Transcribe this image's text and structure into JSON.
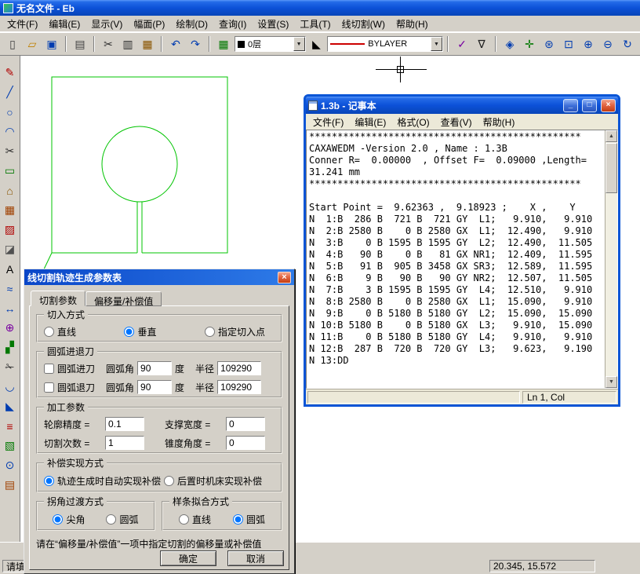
{
  "colors": {
    "titlebar_blue": "#0C51D8",
    "drawing_green": "#00C400",
    "bylayer_red": "#CC0000",
    "layer_chip": "#000000"
  },
  "app": {
    "title": "无名文件 - Eb",
    "menu": [
      "文件(F)",
      "编辑(E)",
      "显示(V)",
      "幅面(P)",
      "绘制(D)",
      "查询(I)",
      "设置(S)",
      "工具(T)",
      "线切割(W)",
      "帮助(H)"
    ],
    "toolbar": {
      "dropdown_glyph": "▼",
      "color_glyph": "◣",
      "layer_value": "0层",
      "line_value": "BYLAYER",
      "file_icons": [
        {
          "name": "new-file-icon",
          "glyph": "▯",
          "color": "#404040"
        },
        {
          "name": "open-file-icon",
          "glyph": "▱",
          "color": "#c08000"
        },
        {
          "name": "save-file-icon",
          "glyph": "▣",
          "color": "#003cb0"
        }
      ],
      "print_icons": [
        {
          "name": "print-icon",
          "glyph": "▤",
          "color": "#404040"
        }
      ],
      "edit_icons": [
        {
          "name": "cut-icon",
          "glyph": "✂",
          "color": "#303030"
        },
        {
          "name": "copy-icon",
          "glyph": "▥",
          "color": "#303030"
        },
        {
          "name": "paste-icon",
          "glyph": "▦",
          "color": "#8a5500"
        }
      ],
      "undo_icons": [
        {
          "name": "undo-icon",
          "glyph": "↶",
          "color": "#003cb0"
        },
        {
          "name": "redo-icon",
          "glyph": "↷",
          "color": "#003cb0"
        }
      ],
      "layer_icons": [
        {
          "name": "layers-icon",
          "glyph": "▦",
          "color": "#007800"
        }
      ],
      "pen_icons": [
        {
          "name": "style-check-icon",
          "glyph": "✓",
          "color": "#7800a0"
        },
        {
          "name": "nabla-tool-icon",
          "glyph": "∇",
          "color": "#202020"
        }
      ],
      "view_icons": [
        {
          "name": "show-all-icon",
          "glyph": "◈",
          "color": "#003cb0"
        },
        {
          "name": "pan-view-icon",
          "glyph": "✛",
          "color": "#007800"
        },
        {
          "name": "zoom-dynamic-icon",
          "glyph": "⊛",
          "color": "#003cb0"
        },
        {
          "name": "zoom-window-icon",
          "glyph": "⊡",
          "color": "#003cb0"
        },
        {
          "name": "zoom-in-icon",
          "glyph": "⊕",
          "color": "#003cb0"
        },
        {
          "name": "zoom-out-icon",
          "glyph": "⊖",
          "color": "#003cb0"
        },
        {
          "name": "refresh-view-icon",
          "glyph": "↻",
          "color": "#003cb0"
        }
      ],
      "left_icons": [
        {
          "name": "sketch-pencil-icon",
          "glyph": "✎",
          "color": "#b00000"
        },
        {
          "name": "line-tool-icon",
          "glyph": "╱",
          "color": "#003cb0"
        },
        {
          "name": "circle-tool-icon",
          "glyph": "○",
          "color": "#003cb0"
        },
        {
          "name": "arc-tool-icon",
          "glyph": "◠",
          "color": "#003cb0"
        },
        {
          "name": "scissors-tool-icon",
          "glyph": "✂",
          "color": "#303030"
        },
        {
          "name": "rectangle-tool-icon",
          "glyph": "▭",
          "color": "#007800"
        },
        {
          "name": "home-view-icon",
          "glyph": "⌂",
          "color": "#8a5500"
        },
        {
          "name": "block-tool-icon",
          "glyph": "▦",
          "color": "#a04000"
        },
        {
          "name": "fill-tool-icon",
          "glyph": "▨",
          "color": "#b00000"
        },
        {
          "name": "eraser-tool-icon",
          "glyph": "◪",
          "color": "#505050"
        },
        {
          "name": "text-tool-icon",
          "glyph": "A",
          "color": "#000000"
        },
        {
          "name": "spline-tool-icon",
          "glyph": "≈",
          "color": "#003cb0"
        },
        {
          "name": "dimension-tool-icon",
          "glyph": "↔",
          "color": "#003cb0"
        },
        {
          "name": "node-edit-icon",
          "glyph": "⊕",
          "color": "#7800a0"
        },
        {
          "name": "array-tool-icon",
          "glyph": "▞",
          "color": "#007800"
        },
        {
          "name": "trim-tool-icon",
          "glyph": "✁",
          "color": "#303030"
        },
        {
          "name": "fillet-tool-icon",
          "glyph": "◡",
          "color": "#003cb0"
        },
        {
          "name": "chamfer-tool-icon",
          "glyph": "◣",
          "color": "#003cb0"
        },
        {
          "name": "offset-tool-icon",
          "glyph": "≡",
          "color": "#b00000"
        },
        {
          "name": "hatch-tool-icon",
          "glyph": "▧",
          "color": "#007800"
        },
        {
          "name": "zoom-tool-icon",
          "glyph": "⊙",
          "color": "#003cb0"
        },
        {
          "name": "layer-tool-icon",
          "glyph": "▤",
          "color": "#a04000"
        }
      ]
    },
    "status": {
      "prompt": "请填写",
      "coords": "20.345, 15.572"
    }
  },
  "notepad": {
    "title": "1.3b - 记事本",
    "menu": [
      "文件(F)",
      "编辑(E)",
      "格式(O)",
      "查看(V)",
      "帮助(H)"
    ],
    "btn_min": "_",
    "btn_max": "□",
    "btn_close": "×",
    "scroll_up": "▲",
    "scroll_down": "▼",
    "status_right": "Ln 1, Col",
    "lines": [
      "************************************************",
      "CAXAWEDM -Version 2.0 , Name : 1.3B",
      "Conner R=  0.00000  , Offset F=  0.09000 ,Length=",
      "31.241 mm",
      "************************************************",
      "",
      "Start Point =  9.62363 ,  9.18923 ;    X ,    Y",
      "N  1:B  286 B  721 B  721 GY  L1;   9.910,   9.910",
      "N  2:B 2580 B    0 B 2580 GX  L1;  12.490,   9.910",
      "N  3:B    0 B 1595 B 1595 GY  L2;  12.490,  11.505",
      "N  4:B   90 B    0 B   81 GX NR1;  12.409,  11.595",
      "N  5:B   91 B  905 B 3458 GX SR3;  12.589,  11.595",
      "N  6:B    9 B   90 B   90 GY NR2;  12.507,  11.505",
      "N  7:B    3 B 1595 B 1595 GY  L4;  12.510,   9.910",
      "N  8:B 2580 B    0 B 2580 GX  L1;  15.090,   9.910",
      "N  9:B    0 B 5180 B 5180 GY  L2;  15.090,  15.090",
      "N 10:B 5180 B    0 B 5180 GX  L3;   9.910,  15.090",
      "N 11:B    0 B 5180 B 5180 GY  L4;   9.910,   9.910",
      "N 12:B  287 B  720 B  720 GY  L3;   9.623,   9.190",
      "N 13:DD"
    ]
  },
  "dialog": {
    "title": "线切割轨迹生成参数表",
    "close": "×",
    "tabs": [
      "切割参数",
      "偏移量/补偿值"
    ],
    "cutin": {
      "label": "切入方式",
      "opt_line": "直线",
      "opt_vertical": "垂直",
      "opt_point": "指定切入点"
    },
    "arc": {
      "label": "圆弧进退刀",
      "in_label": "圆弧进刀",
      "out_label": "圆弧退刀",
      "angle_label": "圆弧角",
      "degree_label": "度",
      "radius_label": "半径",
      "in_angle": "90",
      "in_radius": "109290",
      "out_angle": "90",
      "out_radius": "109290"
    },
    "machining": {
      "label": "加工参数",
      "contour_label": "轮廓精度 =",
      "contour": "0.1",
      "support_label": "支撑宽度 =",
      "support": "0",
      "times_label": "切割次数 =",
      "times": "1",
      "taper_label": "锥度角度 =",
      "taper": "0"
    },
    "comp": {
      "label": "补偿实现方式",
      "auto": "轨迹生成时自动实现补偿",
      "post": "后置时机床实现补偿"
    },
    "corner": {
      "label": "拐角过渡方式",
      "sharp": "尖角",
      "arc": "圆弧"
    },
    "spline": {
      "label": "样条拟合方式",
      "line": "直线",
      "arc": "圆弧"
    },
    "note": "请在“偏移量/补偿值”一项中指定切割的偏移量或补偿值",
    "ok": "确定",
    "cancel": "取消"
  }
}
